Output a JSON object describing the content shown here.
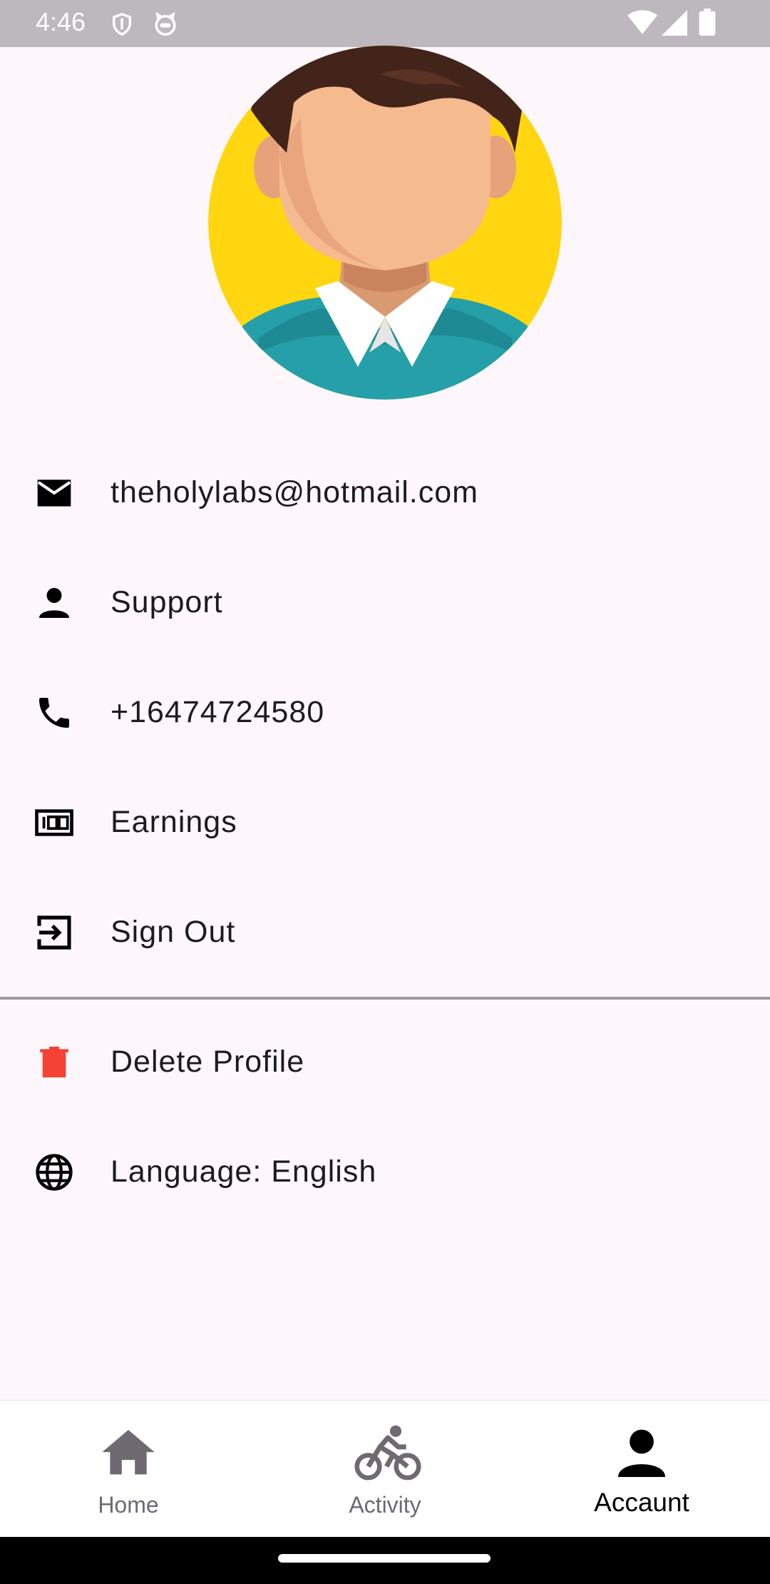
{
  "status_bar": {
    "time": "4:46",
    "icons": [
      "shield-icon",
      "cat-face-icon",
      "wifi-icon",
      "signal-icon",
      "battery-icon"
    ]
  },
  "profile": {
    "avatar_icon": "avatar-illustration",
    "colors": {
      "background": "#ffd60f",
      "shirt": "#25a0a8",
      "hair": "#43241a",
      "skin": "#f6ba8f"
    }
  },
  "menu": {
    "items": [
      {
        "icon": "mail-icon",
        "label": "theholylabs@hotmail.com"
      },
      {
        "icon": "person-icon",
        "label": "Support"
      },
      {
        "icon": "phone-icon",
        "label": "+16474724580"
      },
      {
        "icon": "money-100-icon",
        "label": "Earnings"
      },
      {
        "icon": "sign-out-icon",
        "label": "Sign Out"
      },
      {
        "icon": "trash-icon",
        "label": "Delete Profile",
        "color": "#f44336"
      },
      {
        "icon": "globe-icon",
        "label": "Language: English"
      }
    ]
  },
  "bottom_nav": {
    "tabs": [
      {
        "icon": "home-icon",
        "label": "Home",
        "active": false
      },
      {
        "icon": "bicycle-icon",
        "label": "Activity",
        "active": false
      },
      {
        "icon": "person-icon",
        "label": "Accaunt",
        "active": true
      }
    ]
  }
}
